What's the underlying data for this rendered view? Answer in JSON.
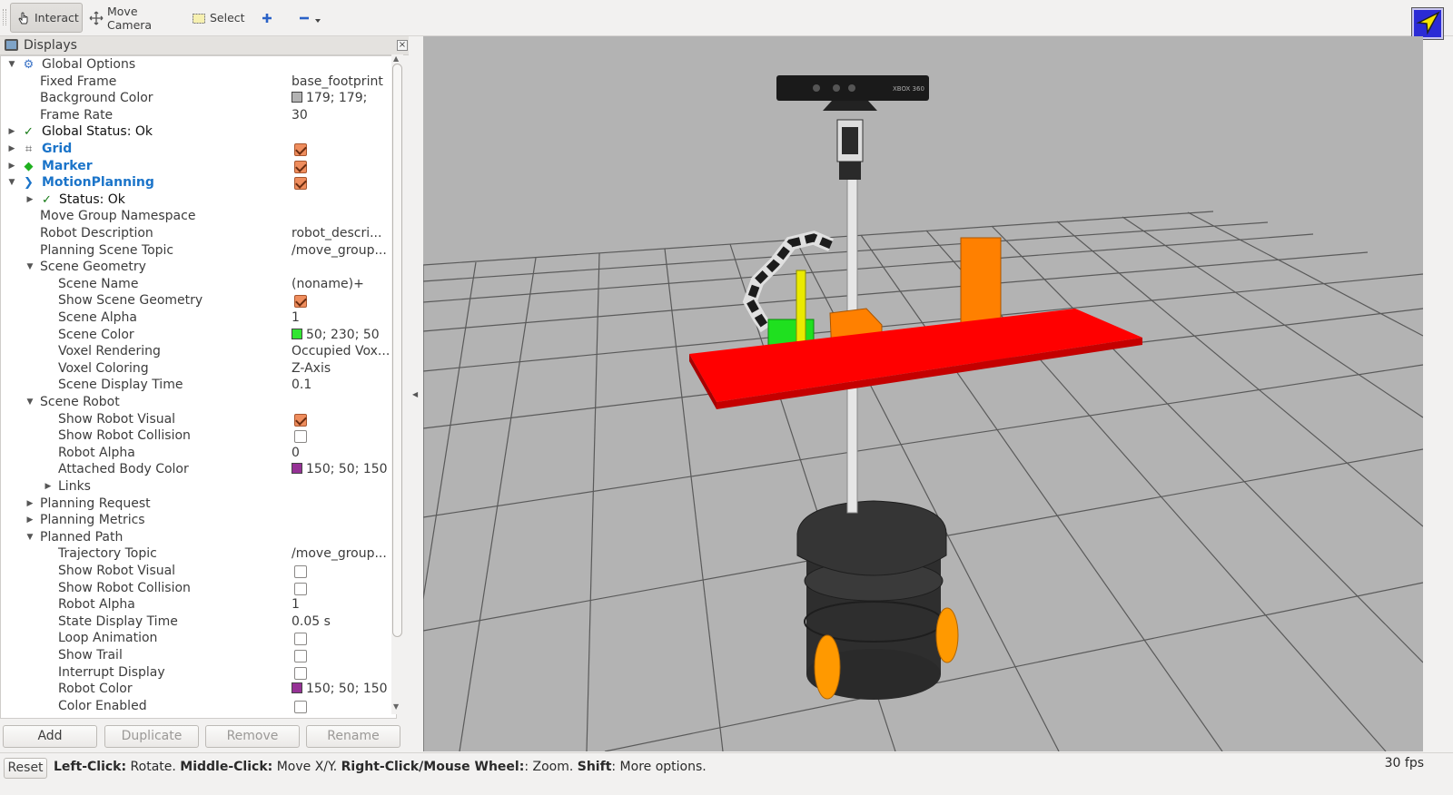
{
  "toolbar": {
    "interact": "Interact",
    "move_camera": "Move Camera",
    "select": "Select",
    "add_icon": "plus-icon",
    "remove_icon": "minus-icon"
  },
  "displays_panel": {
    "title": "Displays",
    "rows": [
      {
        "label": "Global Options",
        "value": "",
        "depth": 0,
        "expander": "open",
        "icon": "gear-icon",
        "style": "normal"
      },
      {
        "label": "Fixed Frame",
        "value": "base_footprint",
        "depth": 1,
        "expander": "none",
        "icon": "",
        "style": "normal"
      },
      {
        "label": "Background Color",
        "value": "179; 179;",
        "depth": 1,
        "expander": "none",
        "icon": "",
        "style": "normal",
        "swatch": "#b3b3b3"
      },
      {
        "label": "Frame Rate",
        "value": "30",
        "depth": 1,
        "expander": "none",
        "icon": "",
        "style": "normal"
      },
      {
        "label": "Global Status: Ok",
        "value": "",
        "depth": 0,
        "expander": "closed",
        "icon": "check-icon",
        "style": "black"
      },
      {
        "label": "Grid",
        "value": "",
        "depth": 0,
        "expander": "closed",
        "icon": "grid-icon",
        "style": "bold",
        "checkbox": true
      },
      {
        "label": "Marker",
        "value": "",
        "depth": 0,
        "expander": "closed",
        "icon": "cube-icon",
        "style": "bold",
        "checkbox": true
      },
      {
        "label": "MotionPlanning",
        "value": "",
        "depth": 0,
        "expander": "open",
        "icon": "arrow-icon",
        "style": "bold",
        "checkbox": true
      },
      {
        "label": "Status: Ok",
        "value": "",
        "depth": 1,
        "expander": "closed",
        "icon": "check-icon",
        "style": "black"
      },
      {
        "label": "Move Group Namespace",
        "value": "",
        "depth": 1,
        "expander": "none",
        "icon": "",
        "style": "normal"
      },
      {
        "label": "Robot Description",
        "value": "robot_descri...",
        "depth": 1,
        "expander": "none",
        "icon": "",
        "style": "normal"
      },
      {
        "label": "Planning Scene Topic",
        "value": "/move_group...",
        "depth": 1,
        "expander": "none",
        "icon": "",
        "style": "normal"
      },
      {
        "label": "Scene Geometry",
        "value": "",
        "depth": 1,
        "expander": "open",
        "icon": "",
        "style": "normal"
      },
      {
        "label": "Scene Name",
        "value": "(noname)+",
        "depth": 2,
        "expander": "none",
        "icon": "",
        "style": "normal"
      },
      {
        "label": "Show Scene Geometry",
        "value": "",
        "depth": 2,
        "expander": "none",
        "icon": "",
        "style": "normal",
        "checkbox": true
      },
      {
        "label": "Scene Alpha",
        "value": "1",
        "depth": 2,
        "expander": "none",
        "icon": "",
        "style": "normal"
      },
      {
        "label": "Scene Color",
        "value": "50; 230; 50",
        "depth": 2,
        "expander": "none",
        "icon": "",
        "style": "normal",
        "swatch": "#32e632"
      },
      {
        "label": "Voxel Rendering",
        "value": "Occupied Vox...",
        "depth": 2,
        "expander": "none",
        "icon": "",
        "style": "normal"
      },
      {
        "label": "Voxel Coloring",
        "value": "Z-Axis",
        "depth": 2,
        "expander": "none",
        "icon": "",
        "style": "normal"
      },
      {
        "label": "Scene Display Time",
        "value": "0.1",
        "depth": 2,
        "expander": "none",
        "icon": "",
        "style": "normal"
      },
      {
        "label": "Scene Robot",
        "value": "",
        "depth": 1,
        "expander": "open",
        "icon": "",
        "style": "normal"
      },
      {
        "label": "Show Robot Visual",
        "value": "",
        "depth": 2,
        "expander": "none",
        "icon": "",
        "style": "normal",
        "checkbox": true
      },
      {
        "label": "Show Robot Collision",
        "value": "",
        "depth": 2,
        "expander": "none",
        "icon": "",
        "style": "normal",
        "checkbox": false
      },
      {
        "label": "Robot Alpha",
        "value": "0",
        "depth": 2,
        "expander": "none",
        "icon": "",
        "style": "normal"
      },
      {
        "label": "Attached Body Color",
        "value": "150; 50; 150",
        "depth": 2,
        "expander": "none",
        "icon": "",
        "style": "normal",
        "swatch": "#963296"
      },
      {
        "label": "Links",
        "value": "",
        "depth": 2,
        "expander": "closed",
        "icon": "",
        "style": "normal"
      },
      {
        "label": "Planning Request",
        "value": "",
        "depth": 1,
        "expander": "closed",
        "icon": "",
        "style": "normal"
      },
      {
        "label": "Planning Metrics",
        "value": "",
        "depth": 1,
        "expander": "closed",
        "icon": "",
        "style": "normal"
      },
      {
        "label": "Planned Path",
        "value": "",
        "depth": 1,
        "expander": "open",
        "icon": "",
        "style": "normal"
      },
      {
        "label": "Trajectory Topic",
        "value": "/move_group...",
        "depth": 2,
        "expander": "none",
        "icon": "",
        "style": "normal"
      },
      {
        "label": "Show Robot Visual",
        "value": "",
        "depth": 2,
        "expander": "none",
        "icon": "",
        "style": "normal",
        "checkbox": false
      },
      {
        "label": "Show Robot Collision",
        "value": "",
        "depth": 2,
        "expander": "none",
        "icon": "",
        "style": "normal",
        "checkbox": false
      },
      {
        "label": "Robot Alpha",
        "value": "1",
        "depth": 2,
        "expander": "none",
        "icon": "",
        "style": "normal"
      },
      {
        "label": "State Display Time",
        "value": "0.05 s",
        "depth": 2,
        "expander": "none",
        "icon": "",
        "style": "normal"
      },
      {
        "label": "Loop Animation",
        "value": "",
        "depth": 2,
        "expander": "none",
        "icon": "",
        "style": "normal",
        "checkbox": false
      },
      {
        "label": "Show Trail",
        "value": "",
        "depth": 2,
        "expander": "none",
        "icon": "",
        "style": "normal",
        "checkbox": false
      },
      {
        "label": "Interrupt Display",
        "value": "",
        "depth": 2,
        "expander": "none",
        "icon": "",
        "style": "normal",
        "checkbox": false
      },
      {
        "label": "Robot Color",
        "value": "150; 50; 150",
        "depth": 2,
        "expander": "none",
        "icon": "",
        "style": "normal",
        "swatch": "#963296"
      },
      {
        "label": "Color Enabled",
        "value": "",
        "depth": 2,
        "expander": "none",
        "icon": "",
        "style": "normal",
        "checkbox": false
      }
    ],
    "buttons": {
      "add": "Add",
      "duplicate": "Duplicate",
      "remove": "Remove",
      "rename": "Rename"
    }
  },
  "viewport": {
    "background": "#b3b3b3",
    "table_color": "#ff0000",
    "box_color": "#ff8000",
    "scene_color": "#32e632",
    "kinect_label": "XBOX 360"
  },
  "statusbar": {
    "reset": "Reset",
    "hint_parts": [
      {
        "text": "Left-Click:",
        "bold": true
      },
      {
        "text": " Rotate. ",
        "bold": false
      },
      {
        "text": "Middle-Click:",
        "bold": true
      },
      {
        "text": " Move X/Y. ",
        "bold": false
      },
      {
        "text": "Right-Click/Mouse Wheel:",
        "bold": true
      },
      {
        "text": ": Zoom. ",
        "bold": false
      },
      {
        "text": "Shift",
        "bold": true
      },
      {
        "text": ": More options.",
        "bold": false
      }
    ],
    "fps": "30 fps"
  }
}
